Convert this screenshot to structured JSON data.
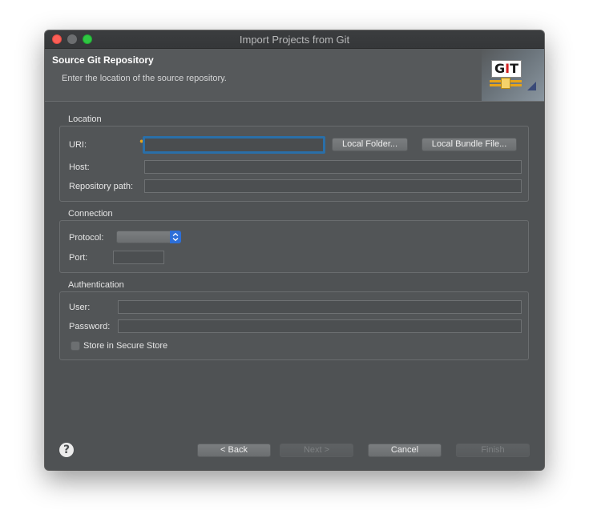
{
  "window": {
    "title": "Import Projects from Git"
  },
  "header": {
    "title": "Source Git Repository",
    "description": "Enter the location of the source repository.",
    "logo_text": "GIT"
  },
  "location": {
    "group_label": "Location",
    "uri_label": "URI:",
    "uri_value": "",
    "local_folder_button": "Local Folder...",
    "local_bundle_button": "Local Bundle File...",
    "host_label": "Host:",
    "host_value": "",
    "repo_path_label": "Repository path:",
    "repo_path_value": ""
  },
  "connection": {
    "group_label": "Connection",
    "protocol_label": "Protocol:",
    "protocol_value": "",
    "port_label": "Port:",
    "port_value": ""
  },
  "authentication": {
    "group_label": "Authentication",
    "user_label": "User:",
    "user_value": "",
    "password_label": "Password:",
    "password_value": "",
    "store_label": "Store in Secure Store",
    "store_checked": false
  },
  "footer": {
    "help_glyph": "?",
    "back": "< Back",
    "next": "Next >",
    "cancel": "Cancel",
    "finish": "Finish"
  },
  "colors": {
    "window_bg": "#4f5254",
    "focus_ring": "#2a6fa8",
    "select_accent": "#2d6fd8",
    "close": "#fc5f57",
    "zoom": "#2fc842"
  }
}
